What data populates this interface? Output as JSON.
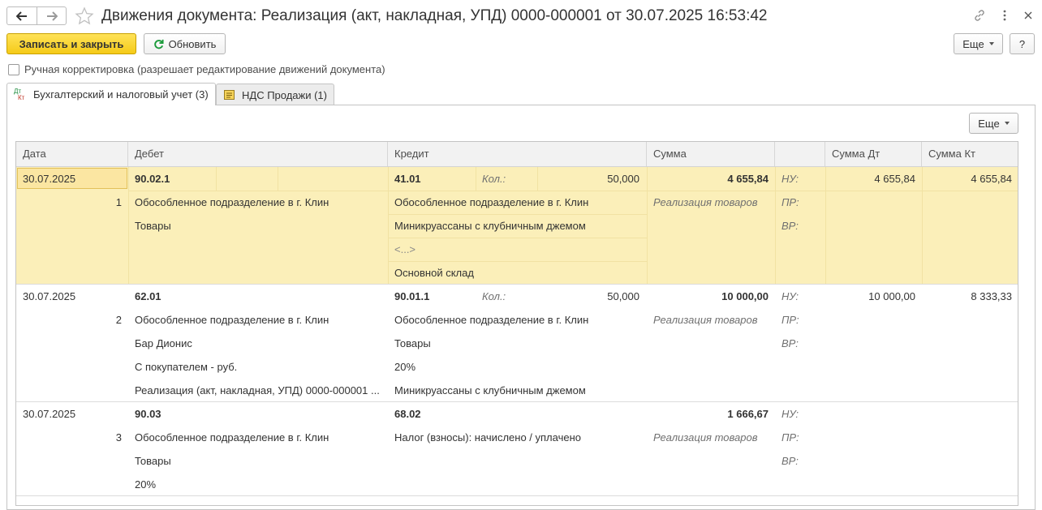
{
  "window": {
    "title": "Движения документа: Реализация (акт, накладная, УПД) 0000-000001 от 30.07.2025 16:53:42",
    "icons": [
      "back-arrow-icon",
      "forward-arrow-icon",
      "star-icon",
      "link-icon",
      "more-vertical-icon",
      "close-icon"
    ]
  },
  "toolbar": {
    "save_close_label": "Записать и закрыть",
    "refresh_label": "Обновить",
    "more_label": "Еще",
    "help_label": "?"
  },
  "manual": {
    "label": "Ручная корректировка (разрешает редактирование движений документа)",
    "checked": false
  },
  "tabs": [
    {
      "icon": "dt-kt-icon",
      "icon_top": "Дт",
      "icon_bottom": "Кт",
      "label": "Бухгалтерский и налоговый учет (3)",
      "active": true
    },
    {
      "icon": "register-icon",
      "label": "НДС Продажи (1)",
      "active": false
    }
  ],
  "table": {
    "more_label": "Еще",
    "headers": {
      "date": "Дата",
      "debit": "Дебет",
      "credit": "Кредит",
      "sum": "Сумма",
      "blank": "",
      "sum_dt": "Сумма Дт",
      "sum_kt": "Сумма Кт"
    },
    "rows": [
      {
        "date": "30.07.2025",
        "num": "1",
        "debit_account": "90.02.1",
        "debit_lines": [
          "Обособленное подразделение в г. Клин",
          "Товары"
        ],
        "credit_account": "41.01",
        "qty_label": "Кол.:",
        "qty": "50,000",
        "credit_lines": [
          "Обособленное подразделение в г. Клин",
          "Миникруассаны с клубничным джемом",
          "<...>",
          "Основной склад"
        ],
        "sum": "4 655,84",
        "content": "Реализация товаров",
        "labels": [
          "НУ:",
          "ПР:",
          "ВР:"
        ],
        "sum_dt": "4 655,84",
        "sum_kt": "4 655,84"
      },
      {
        "date": "30.07.2025",
        "num": "2",
        "debit_account": "62.01",
        "debit_lines": [
          "Обособленное подразделение в г. Клин",
          "Бар Дионис",
          "С покупателем - руб.",
          "Реализация (акт, накладная, УПД) 0000-000001 ..."
        ],
        "credit_account": "90.01.1",
        "qty_label": "Кол.:",
        "qty": "50,000",
        "credit_lines": [
          "Обособленное подразделение в г. Клин",
          "Товары",
          "20%",
          "Миникруассаны с клубничным джемом"
        ],
        "sum": "10 000,00",
        "content": "Реализация товаров",
        "labels": [
          "НУ:",
          "ПР:",
          "ВР:"
        ],
        "sum_dt": "10 000,00",
        "sum_kt": "8 333,33"
      },
      {
        "date": "30.07.2025",
        "num": "3",
        "debit_account": "90.03",
        "debit_lines": [
          "Обособленное подразделение в г. Клин",
          "Товары",
          "20%"
        ],
        "credit_account": "68.02",
        "credit_lines": [
          "Налог (взносы): начислено / уплачено"
        ],
        "sum": "1 666,67",
        "content": "Реализация товаров",
        "labels": [
          "НУ:",
          "ПР:",
          "ВР:"
        ]
      }
    ]
  },
  "colors": {
    "accent_yellow": "#f5cb18",
    "selected_row": "#fbefb9",
    "border": "#c4c4c4"
  }
}
